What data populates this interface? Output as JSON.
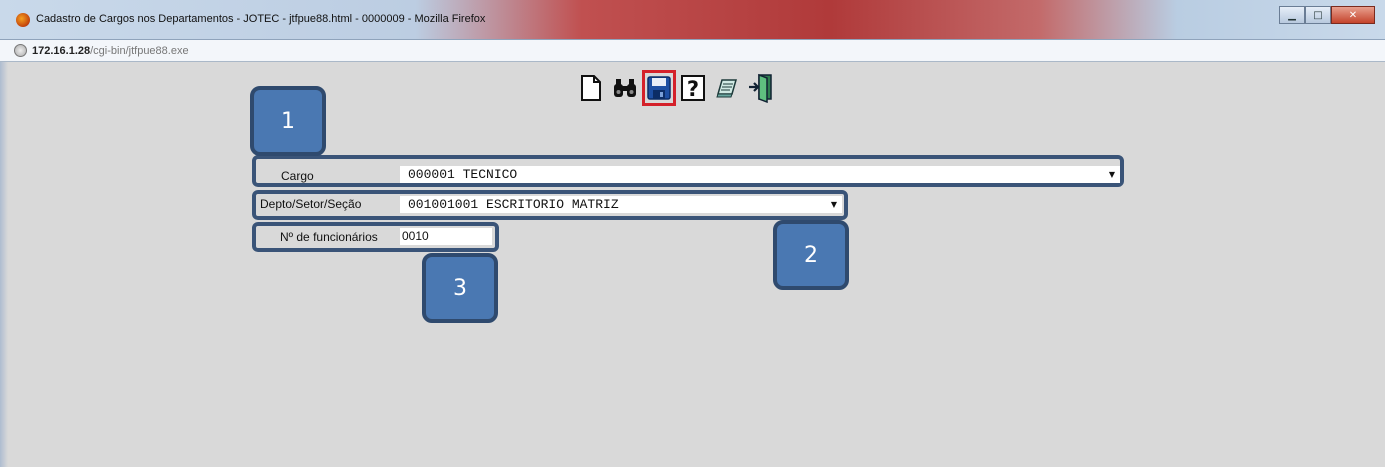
{
  "window": {
    "title": "Cadastro de Cargos nos Departamentos - JOTEC - jtfpue88.html - 0000009 - Mozilla Firefox",
    "controls": [
      "minimize-icon",
      "maximize-icon",
      "close-icon"
    ]
  },
  "address": {
    "host": "172.16.1.28",
    "path": "/cgi-bin/jtfpue88.exe"
  },
  "toolbar": {
    "icons": [
      "new-document-icon",
      "binoculars-search-icon",
      "save-floppy-icon",
      "help-question-icon",
      "notes-icon",
      "exit-door-icon"
    ],
    "highlighted": "save-floppy-icon",
    "highlight_color": "#d4212a"
  },
  "form": {
    "cargo_label": "Cargo",
    "cargo_value": "000001 TECNICO",
    "depto_label": "Depto/Setor/Seção",
    "depto_value": "001001001 ESCRITORIO MATRIZ",
    "func_label": "Nº de funcionários",
    "func_value": "0010"
  },
  "callouts": [
    "1",
    "2",
    "3"
  ],
  "colors": {
    "callout_fill": "#4a78b2",
    "callout_border": "#2f4a6e",
    "background": "#d9d9d9"
  }
}
